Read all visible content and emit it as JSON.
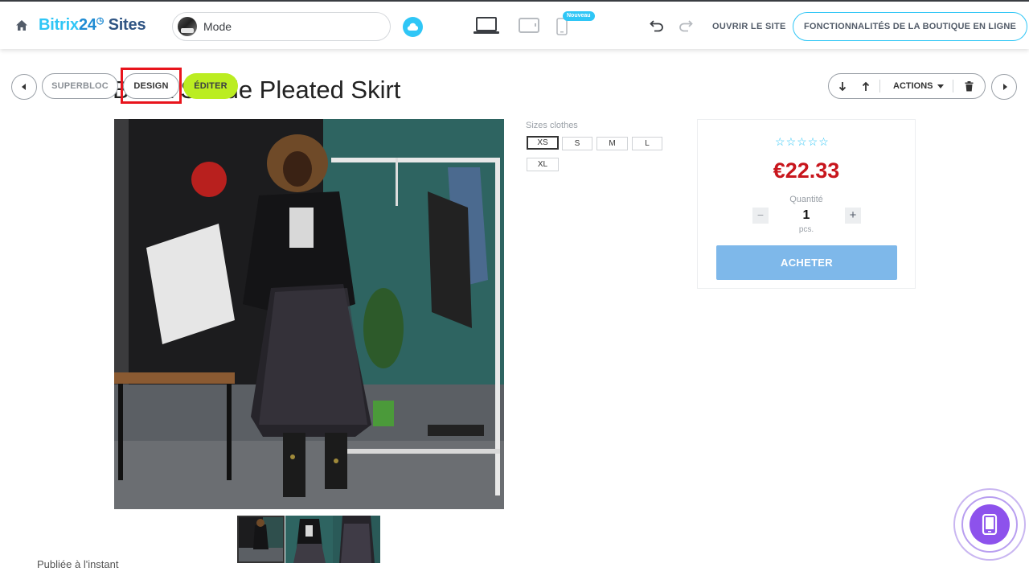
{
  "app": {
    "logo_part1": "Bitrix",
    "logo_part2": "24",
    "logo_part3": "Sites",
    "site_name": "Mode",
    "new_badge": "Nouveau",
    "open_site": "OUVRIR LE SITE",
    "shop_features": "FONCTIONNALITÉS DE LA BOUTIQUE EN LIGNE"
  },
  "block_toolbar": {
    "superbloc": "SUPERBLOC",
    "design": "DESIGN",
    "editer": "ÉDITER",
    "actions": "ACTIONS"
  },
  "product": {
    "title": "Black Suede Pleated Skirt",
    "sizes_label": "Sizes clothes",
    "sizes": [
      "XS",
      "S",
      "M",
      "L",
      "XL"
    ],
    "selected_size": "XS",
    "rating_stars": 5,
    "rating_value": 0,
    "price": "€22.33",
    "quantity_label": "Quantité",
    "quantity": "1",
    "unit": "pcs.",
    "buy_label": "ACHETER"
  },
  "footer": {
    "published": "Publiée à l'instant"
  },
  "colors": {
    "accent": "#2fc6f6",
    "price": "#c8161d",
    "edit_button": "#bbed21",
    "buy_button": "#7eb8ea",
    "highlight": "#e8141c",
    "mobile_fab": "#8d52ec"
  },
  "icons": [
    "home-icon",
    "cloud-icon",
    "laptop-icon",
    "tablet-icon",
    "phone-icon",
    "undo-icon",
    "redo-icon",
    "arrow-down-icon",
    "arrow-up-icon",
    "caret-down-icon",
    "trash-icon",
    "star-icon",
    "mobile-preview-icon"
  ]
}
